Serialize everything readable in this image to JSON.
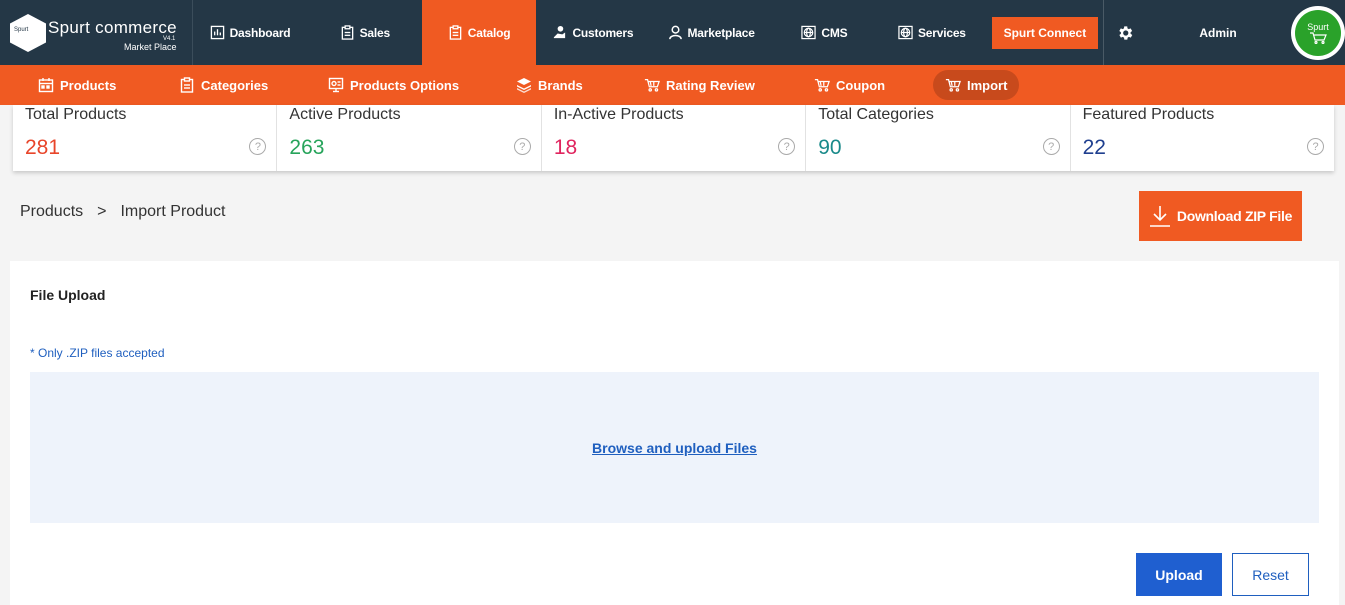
{
  "brand": {
    "name": "Spurt commerce",
    "version": "V4.1",
    "subtitle": "Market Place",
    "badge": "Spurt"
  },
  "nav": {
    "items": [
      {
        "label": "Dashboard",
        "icon": "dashboard-icon"
      },
      {
        "label": "Sales",
        "icon": "clipboard-icon"
      },
      {
        "label": "Catalog",
        "icon": "clipboard-icon",
        "active": true
      },
      {
        "label": "Customers",
        "icon": "customers-icon"
      },
      {
        "label": "Marketplace",
        "icon": "user-icon"
      },
      {
        "label": "CMS",
        "icon": "globe-icon"
      },
      {
        "label": "Services",
        "icon": "globe-icon"
      }
    ],
    "connect": "Spurt Connect",
    "user": "Admin",
    "avatar_text": "Spurt"
  },
  "subnav": {
    "items": [
      {
        "label": "Products",
        "icon": "calendar-icon"
      },
      {
        "label": "Categories",
        "icon": "clipboard-icon"
      },
      {
        "label": "Products Options",
        "icon": "options-icon"
      },
      {
        "label": "Brands",
        "icon": "layers-icon"
      },
      {
        "label": "Rating Review",
        "icon": "cart-icon"
      },
      {
        "label": "Coupon",
        "icon": "cart-icon"
      },
      {
        "label": "Import",
        "icon": "cart-icon",
        "active": true
      }
    ]
  },
  "stats": [
    {
      "label": "Total Products",
      "value": "281",
      "color": "#e8452a"
    },
    {
      "label": "Active Products",
      "value": "263",
      "color": "#27a45b"
    },
    {
      "label": "In-Active Products",
      "value": "18",
      "color": "#e0245e"
    },
    {
      "label": "Total Categories",
      "value": "90",
      "color": "#1a8a8a"
    },
    {
      "label": "Featured Products",
      "value": "22",
      "color": "#1f3f8f"
    }
  ],
  "stats_help": "?",
  "breadcrumb": {
    "root": "Products",
    "separator": ">",
    "current": "Import Product"
  },
  "download_label": "Download ZIP File",
  "upload": {
    "title": "File Upload",
    "note": "* Only .ZIP files accepted",
    "browse": "Browse and upload Files",
    "submit": "Upload",
    "reset": "Reset"
  },
  "colors": {
    "accent": "#f05a22",
    "nav_bg": "#243746",
    "primary": "#1f5fd0"
  }
}
